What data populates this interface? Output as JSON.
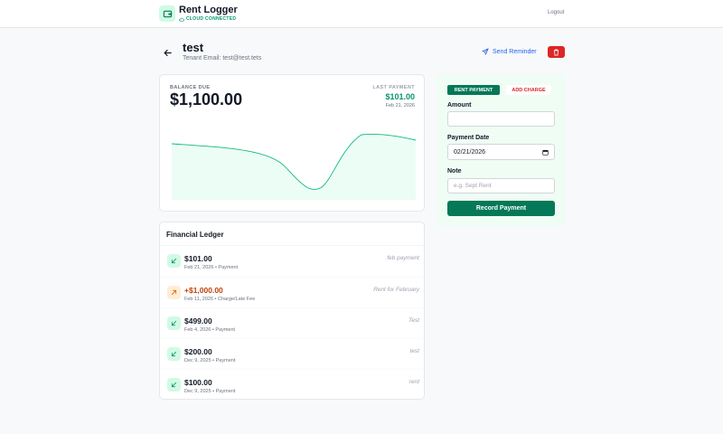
{
  "app": {
    "title": "Rent Logger",
    "status": "CLOUD CONNECTED",
    "logout_label": "Logout"
  },
  "tenant": {
    "name": "test",
    "email_text": "Tenant Email: test@test.tets"
  },
  "actions": {
    "send_reminder_label": "Send Reminder"
  },
  "balance": {
    "label": "BALANCE DUE",
    "value": "$1,100.00",
    "last_payment_label": "LAST PAYMENT",
    "last_payment_value": "$101.00",
    "last_payment_date": "Feb 21, 2026"
  },
  "ledger": {
    "title": "Financial Ledger",
    "entries": [
      {
        "amount": "$101.00",
        "meta": "Feb 21, 2026 • Payment",
        "note": "feb payment",
        "kind": "payment"
      },
      {
        "amount": "+$1,000.00",
        "meta": "Feb 11, 2026 • Charge/Late Fee",
        "note": "Rent for February",
        "kind": "charge"
      },
      {
        "amount": "$499.00",
        "meta": "Feb 4, 2026 • Payment",
        "note": "Test",
        "kind": "payment"
      },
      {
        "amount": "$200.00",
        "meta": "Dec 9, 2025 • Payment",
        "note": "test",
        "kind": "payment"
      },
      {
        "amount": "$100.00",
        "meta": "Dec 9, 2025 • Payment",
        "note": "rent",
        "kind": "payment"
      }
    ]
  },
  "form": {
    "tab_payment": "RENT PAYMENT",
    "tab_charge": "ADD CHARGE",
    "amount_label": "Amount",
    "amount_value": "",
    "date_label": "Payment Date",
    "date_value": "02/21/2026",
    "note_label": "Note",
    "note_placeholder": "e.g. Sept Rent",
    "submit_label": "Record Payment"
  },
  "colors": {
    "accent": "#047857",
    "payment": "#059669",
    "charge": "#c2410c",
    "danger": "#dc2626",
    "link": "#2563eb"
  },
  "icons": {
    "logo": "wallet-icon",
    "status": "cloud-icon",
    "back": "arrow-left-icon",
    "reminder": "send-icon",
    "delete": "trash-icon",
    "payment_row": "arrow-down-left-icon",
    "charge_row": "arrow-up-right-icon",
    "date_picker": "calendar-icon"
  }
}
